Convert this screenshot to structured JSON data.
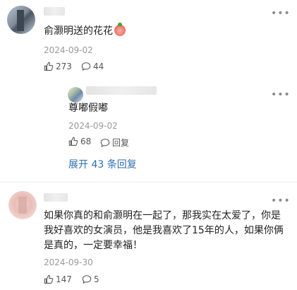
{
  "comments": [
    {
      "text": "俞灏明送的花花",
      "date": "2024-09-02",
      "likes": "273",
      "comments_count": "44",
      "reply": {
        "text": "尊嘟假嘟",
        "date": "2024-09-02",
        "likes": "68",
        "reply_label": "回复"
      },
      "expand_label": "展开 43 条回复"
    },
    {
      "text": "如果你真的和俞灏明在一起了，那我实在太爱了，你是我好喜欢的女演员，他是我喜欢了15年的人，如果你俩是真的，一定要幸福！",
      "date": "2024-09-30",
      "likes": "147",
      "comments_count": "5"
    }
  ],
  "icons": {
    "more": "more-icon",
    "like": "thumbs-up-icon",
    "comment": "comment-bubble-icon",
    "emoji": "peach-emoji-icon"
  },
  "colors": {
    "link": "#2f6fad",
    "date": "#9a9a9a"
  }
}
